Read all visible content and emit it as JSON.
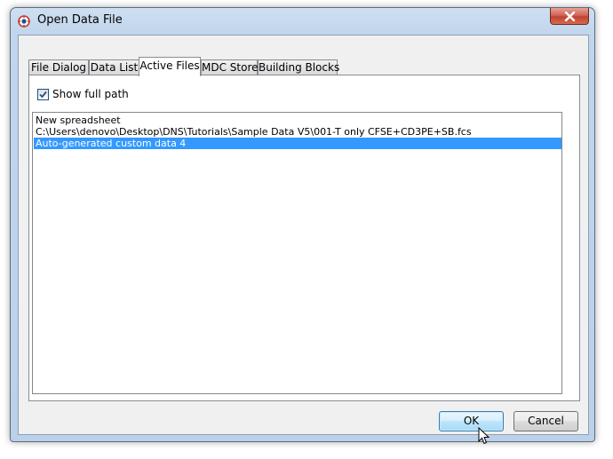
{
  "window": {
    "title": "Open Data File",
    "icon": "app-logo-icon"
  },
  "tabs": [
    {
      "label": "File Dialog",
      "active": false
    },
    {
      "label": "Data List",
      "active": false
    },
    {
      "label": "Active Files",
      "active": true
    },
    {
      "label": "MDC Store",
      "active": false
    },
    {
      "label": "Building Blocks",
      "active": false
    }
  ],
  "options": {
    "show_full_path_label": "Show full path",
    "show_full_path_checked": true
  },
  "file_list": [
    {
      "label": "New spreadsheet",
      "selected": false
    },
    {
      "label": "C:\\Users\\denovo\\Desktop\\DNS\\Tutorials\\Sample Data V5\\001-T only CFSE+CD3PE+SB.fcs",
      "selected": false
    },
    {
      "label": "Auto-generated custom data 4",
      "selected": true
    }
  ],
  "buttons": {
    "ok_label": "OK",
    "cancel_label": "Cancel"
  },
  "colors": {
    "selection": "#3399ff",
    "close_button": "#c1432f"
  }
}
